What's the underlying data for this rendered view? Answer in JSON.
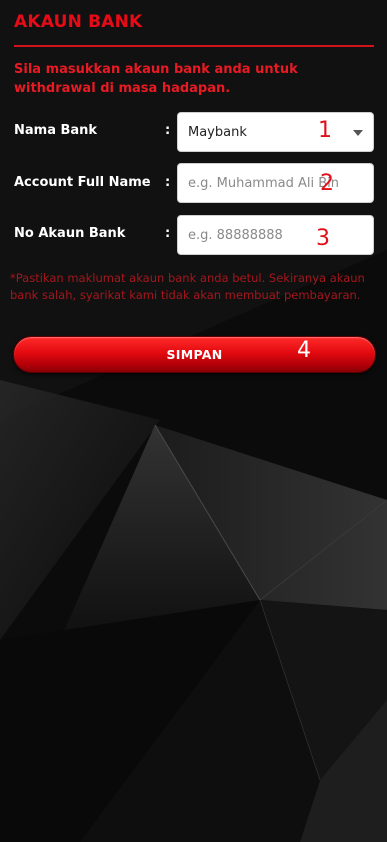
{
  "form": {
    "title": "AKAUN BANK",
    "intro": "Sila masukkan akaun bank anda untuk withdrawal di masa hadapan.",
    "rows": [
      {
        "label": "Nama Bank",
        "colon": ":",
        "value": "Maybank",
        "marker": "1"
      },
      {
        "label": "Account Full Name",
        "colon": ":",
        "placeholder": "e.g. Muhammad Ali Bin",
        "marker": "2"
      },
      {
        "label": "No Akaun Bank",
        "colon": ":",
        "placeholder": "e.g. 88888888",
        "marker": "3"
      }
    ],
    "note": "*Pastikan maklumat akaun bank anda betul. Sekiranya akaun bank salah, syarikat kami tidak akan membuat pembayaran.",
    "save_label": "SIMPAN",
    "save_marker": "4"
  },
  "colors": {
    "accent": "#e60b17",
    "note": "#a3171d",
    "background": "#0c0c0c"
  },
  "icons": {
    "select_caret": "caret-down-icon"
  }
}
